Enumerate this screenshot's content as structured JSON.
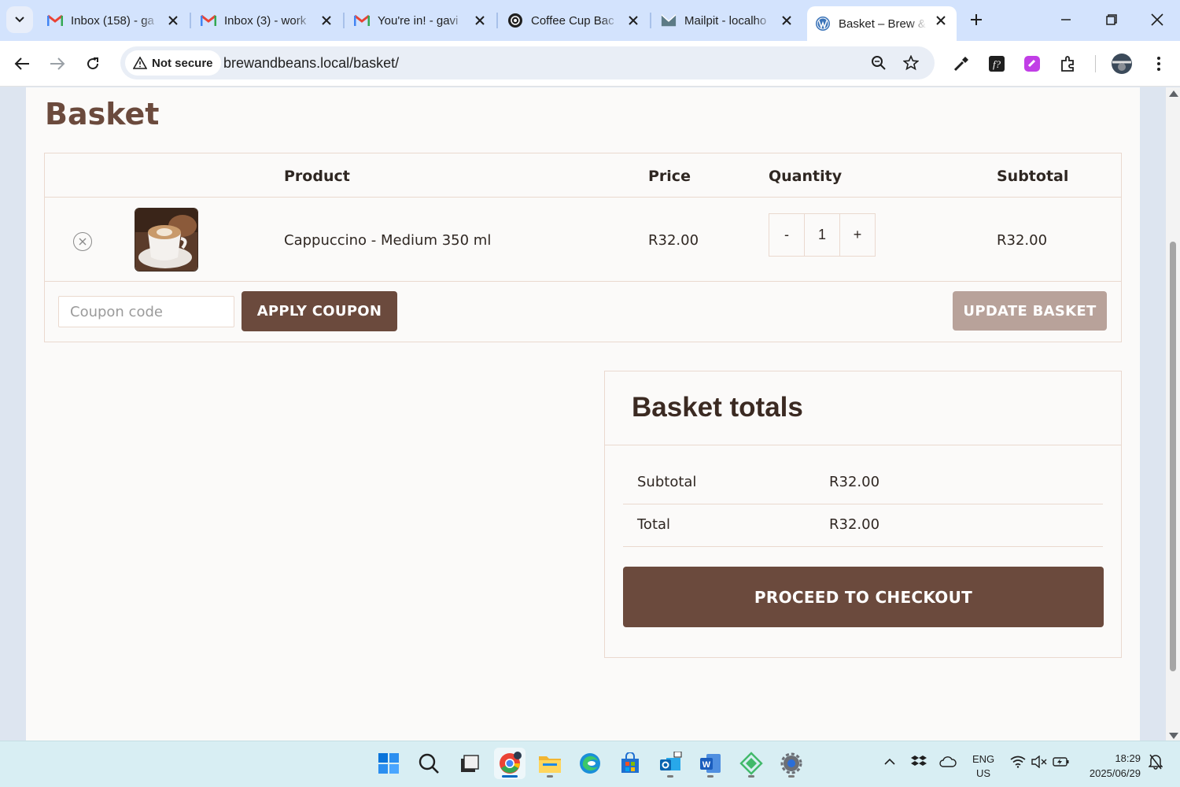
{
  "browser": {
    "tabs": [
      {
        "title": "Inbox (158) - ga",
        "favicon": "gmail-icon"
      },
      {
        "title": "Inbox (3) - work",
        "favicon": "gmail-icon"
      },
      {
        "title": "You're in! - gavi",
        "favicon": "gmail-icon"
      },
      {
        "title": "Coffee Cup Bac",
        "favicon": "openai-icon"
      },
      {
        "title": "Mailpit - localho",
        "favicon": "mailpit-icon"
      },
      {
        "title": "Basket – Brew &",
        "favicon": "wordpress-icon",
        "active": true
      }
    ],
    "security_label": "Not secure",
    "url": "brewandbeans.local/basket/"
  },
  "page": {
    "title": "Basket",
    "table_headers": {
      "product": "Product",
      "price": "Price",
      "quantity": "Quantity",
      "subtotal": "Subtotal"
    },
    "cart_items": [
      {
        "name": "Cappuccino - Medium 350 ml",
        "price": "R32.00",
        "quantity": "1",
        "subtotal": "R32.00"
      }
    ],
    "qty_minus": "-",
    "qty_plus": "+",
    "coupon_placeholder": "Coupon code",
    "apply_coupon_label": "APPLY COUPON",
    "update_basket_label": "UPDATE BASKET",
    "totals": {
      "title": "Basket totals",
      "subtotal_label": "Subtotal",
      "subtotal_value": "R32.00",
      "total_label": "Total",
      "total_value": "R32.00",
      "checkout_label": "PROCEED TO CHECKOUT"
    },
    "colors": {
      "brand": "#6b4a3d",
      "update_disabled": "#b8a29a",
      "border": "#ead9cf"
    }
  },
  "taskbar": {
    "lang_line1": "ENG",
    "lang_line2": "US",
    "time": "18:29",
    "date": "2025/06/29"
  }
}
